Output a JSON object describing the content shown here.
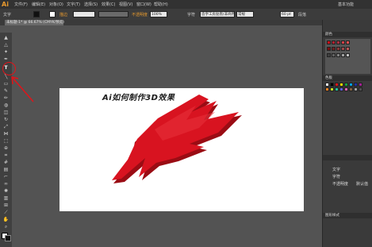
{
  "app": {
    "logo": "Ai"
  },
  "menubar": {
    "items": [
      "文件(F)",
      "编辑(E)",
      "对象(O)",
      "文字(T)",
      "选择(S)",
      "效果(C)",
      "视图(V)",
      "窗口(W)",
      "帮助(H)"
    ],
    "workspace": "基本功能"
  },
  "controlbar": {
    "label": "文字",
    "stroke_label": "描边",
    "opacity_label": "不透明度",
    "opacity_value": "100%",
    "char_label": "字符",
    "font_name": "造字工房劲黑(非商用)",
    "font_style": "常规",
    "font_size": "60 pt",
    "para_label": "段落"
  },
  "document": {
    "tab": "未标题-1* @ 66.67% (CMYK/预览)"
  },
  "artwork": {
    "caption": "Ai如何制作3D效果",
    "shape_color": "#c8101a"
  },
  "panels": {
    "color_label": "颜色",
    "swatch_label": "色板",
    "graphic_style_label": "图形样式",
    "properties": {
      "type": "文字",
      "char": "字符",
      "opacity_link": "不透明度",
      "default_text": "默认值"
    }
  },
  "annotation": {
    "highlight_color": "#e0141a"
  }
}
